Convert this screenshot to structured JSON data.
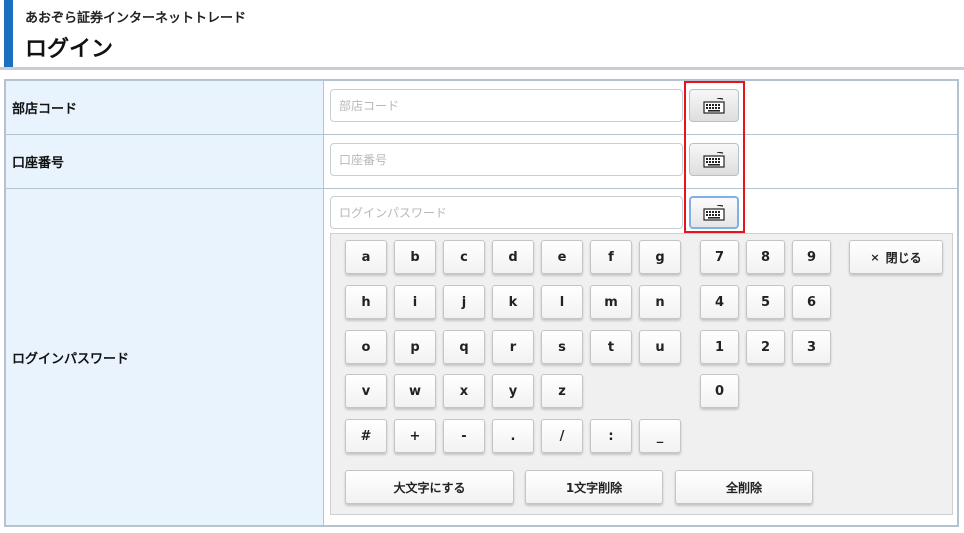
{
  "header": {
    "brand": "あおぞら証券インターネットトレード",
    "title": "ログイン"
  },
  "form": {
    "branch_code": {
      "label": "部店コード",
      "placeholder": "部店コード"
    },
    "account_number": {
      "label": "口座番号",
      "placeholder": "口座番号"
    },
    "password": {
      "label": "ログインパスワード",
      "placeholder": "ログインパスワード"
    }
  },
  "icons": {
    "keyboard": "keyboard-icon"
  },
  "colors": {
    "accent": "#1a6fbf",
    "label_bg": "#e9f3fe",
    "highlight": "#e8141c"
  },
  "keypad": {
    "letters": [
      [
        "a",
        "b",
        "c",
        "d",
        "e",
        "f",
        "g"
      ],
      [
        "h",
        "i",
        "j",
        "k",
        "l",
        "m",
        "n"
      ],
      [
        "o",
        "p",
        "q",
        "r",
        "s",
        "t",
        "u"
      ],
      [
        "v",
        "w",
        "x",
        "y",
        "z"
      ]
    ],
    "symbols": [
      "#",
      "+",
      "-",
      ".",
      "/",
      ":",
      "_"
    ],
    "digits": [
      [
        "7",
        "8",
        "9"
      ],
      [
        "4",
        "5",
        "6"
      ],
      [
        "1",
        "2",
        "3"
      ],
      [
        "0"
      ]
    ],
    "close_label": "閉じる",
    "close_mark": "×",
    "uppercase_label": "大文字にする",
    "delete_one_label": "1文字削除",
    "delete_all_label": "全削除"
  }
}
